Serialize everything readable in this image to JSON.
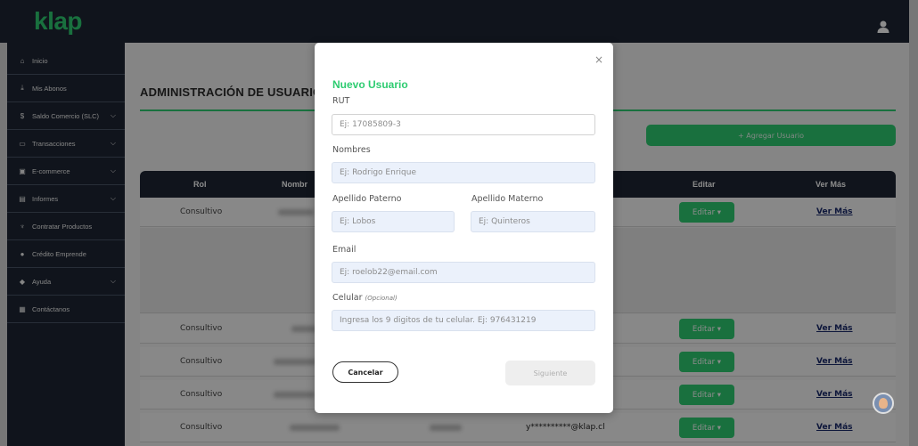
{
  "brand": {
    "name": "klap",
    "accent": "#2ecc71",
    "nav_bg": "#1e2634"
  },
  "header": {
    "user_icon": "user-icon"
  },
  "sidebar": {
    "items": [
      {
        "label": "Inicio",
        "icon": "home-icon",
        "has_chevron": false
      },
      {
        "label": "Mis Abonos",
        "icon": "money-icon",
        "has_chevron": false
      },
      {
        "label": "Saldo Comercio (SLC)",
        "icon": "dollar-icon",
        "has_chevron": true
      },
      {
        "label": "Transacciones",
        "icon": "card-icon",
        "has_chevron": true
      },
      {
        "label": "E-commerce",
        "icon": "cart-icon",
        "has_chevron": true
      },
      {
        "label": "Informes",
        "icon": "document-icon",
        "has_chevron": true
      },
      {
        "label": "Contratar Productos",
        "icon": "handshake-icon",
        "has_chevron": false
      },
      {
        "label": "Crédito Emprende",
        "icon": "credit-icon",
        "has_chevron": false
      },
      {
        "label": "Ayuda",
        "icon": "help-icon",
        "has_chevron": true
      },
      {
        "label": "Contáctanos",
        "icon": "contact-icon",
        "has_chevron": false
      }
    ]
  },
  "page": {
    "title": "ADMINISTRACIÓN DE USUARIO",
    "add_user_label": "+ Agregar Usuario"
  },
  "table": {
    "columns": [
      "Rol",
      "Nombr",
      "Editar",
      "Ver Más"
    ],
    "rows": [
      {
        "rol": "Consultivo",
        "email": "",
        "edit": "Editar ▾",
        "more": "Ver Más"
      },
      {
        "rol": "Consultivo",
        "email": "",
        "edit": "Editar ▾",
        "more": "Ver Más"
      },
      {
        "rol": "Consultivo",
        "email": "",
        "edit": "Editar ▾",
        "more": "Ver Más"
      },
      {
        "rol": "Consultivo",
        "email": "",
        "edit": "Editar ▾",
        "more": "Ver Más"
      },
      {
        "rol": "Consultivo",
        "email": "y**********@klap.cl",
        "edit": "Editar ▾",
        "more": "Ver Más"
      }
    ]
  },
  "modal": {
    "close": "×",
    "title": "Nuevo Usuario",
    "rut": {
      "label": "RUT",
      "placeholder": "Ej: 17085809-3"
    },
    "nombres": {
      "label": "Nombres",
      "placeholder": "Ej: Rodrigo Enrique"
    },
    "apellido_paterno": {
      "label": "Apellido Paterno",
      "placeholder": "Ej: Lobos"
    },
    "apellido_materno": {
      "label": "Apellido Materno",
      "placeholder": "Ej: Quinteros"
    },
    "email": {
      "label": "Email",
      "placeholder": "Ej: roelob22@email.com"
    },
    "celular": {
      "label": "Celular",
      "optional": "(Opcional)",
      "placeholder": "Ingresa los 9 digitos de tu celular. Ej: 976431219"
    },
    "cancel_label": "Cancelar",
    "next_label": "Siguiente"
  }
}
